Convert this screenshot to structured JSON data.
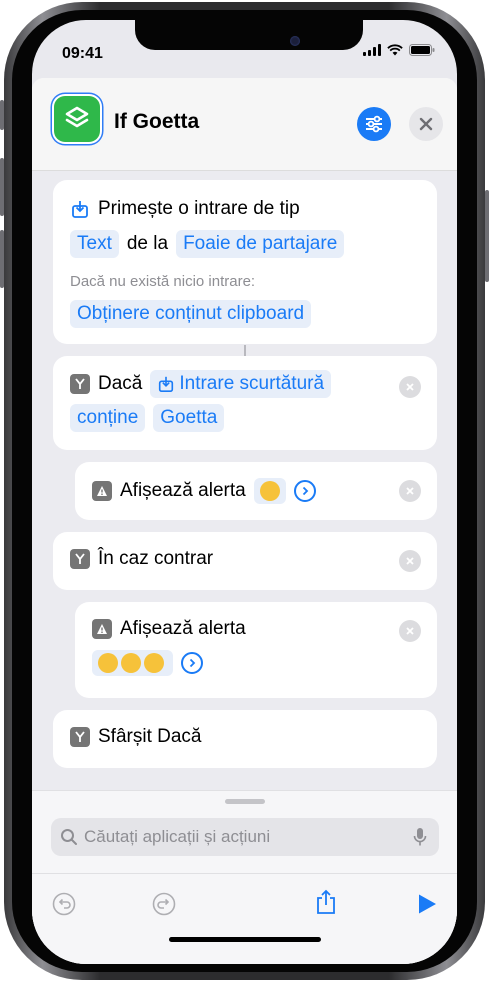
{
  "status_bar": {
    "time": "09:41"
  },
  "header": {
    "title": "If Goetta",
    "app_icon": "shortcuts-icon"
  },
  "steps": {
    "receive": {
      "label": "Primește o intrare de tip",
      "type_token": "Text",
      "from_text": "de la",
      "source_token": "Foaie de partajare",
      "no_input_label": "Dacă nu există nicio intrare:",
      "fallback_token": "Obținere conținut clipboard"
    },
    "if_block": {
      "label": "Dacă",
      "input_token": "Intrare scurtătură",
      "condition_token": "conține",
      "value_token": "Goetta"
    },
    "alert1": {
      "label": "Afișează alerta",
      "emoji": "😁"
    },
    "otherwise": {
      "label": "În caz contrar"
    },
    "alert2": {
      "label": "Afișează alerta",
      "emoji": "😭😭😭"
    },
    "end_if": {
      "label": "Sfârșit Dacă"
    }
  },
  "search": {
    "placeholder": "Căutați aplicații și acțiuni"
  },
  "colors": {
    "accent": "#1a7bf6",
    "app_green": "#2fb84a"
  }
}
